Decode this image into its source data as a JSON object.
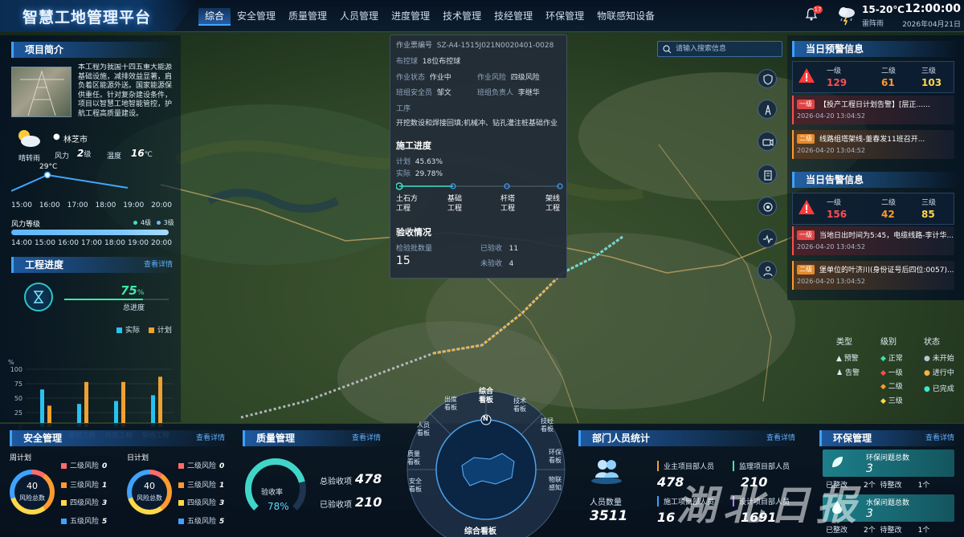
{
  "header": {
    "title": "智慧工地管理平台",
    "nav": [
      "综合",
      "安全管理",
      "质量管理",
      "人员管理",
      "进度管理",
      "技术管理",
      "技经管理",
      "环保管理",
      "物联感知设备"
    ],
    "active_nav": 0,
    "notification_count": "17",
    "weather": {
      "temp": "15-20℃",
      "condition": "雷阵雨"
    },
    "time": "12:00:00",
    "date": "2026年04月21日"
  },
  "project_intro": {
    "title": "项目简介",
    "text": "本工程为我国十四五重大能源基础设施，减排效益显著，肩负着区能源外送。国家能源保供重任。针对复杂建设条件，项目以智慧工地智能管控，护航工程高质量建设。",
    "city": "林芝市",
    "weather_label": "晴转雨",
    "wind_label": "风力",
    "wind_value": "2",
    "wind_unit": "级",
    "temp_label": "温度",
    "temp_value": "16",
    "temp_unit": "℃",
    "current_temp": "29°C",
    "time_ticks": [
      "15:00",
      "16:00",
      "17:00",
      "18:00",
      "19:00",
      "20:00"
    ],
    "wind_level_title": "风力等级",
    "wind_legend": [
      "4级",
      "3级"
    ],
    "wind_ticks": [
      "14:00",
      "15:00",
      "16:00",
      "17:00",
      "18:00",
      "19:00",
      "20:00"
    ]
  },
  "progress": {
    "title": "工程进度",
    "more": "查看详情",
    "percent": "75",
    "percent_unit": "%",
    "label": "总进度",
    "percent_value": 75
  },
  "chart_data": {
    "type": "bar",
    "ylabel": "%",
    "ylim": [
      0,
      100
    ],
    "yticks": [
      "0",
      "25",
      "50",
      "75",
      "100"
    ],
    "categories": [
      "土石方工程",
      "基础工程",
      "杆塔工程",
      "架线工程"
    ],
    "series": [
      {
        "name": "实际",
        "values": [
          65,
          40,
          45,
          55
        ]
      },
      {
        "name": "计划",
        "values": [
          37,
          78,
          78,
          87
        ]
      }
    ],
    "colors": [
      "#27c2f0",
      "#f0a030"
    ]
  },
  "popup": {
    "order_label": "作业票编号",
    "order_value": "SZ-A4-1515J021N0020401-0028",
    "section_label": "布控球",
    "section_value": "18位布控球",
    "status_label": "作业状态",
    "status_value": "作业中",
    "risk_label": "作业风险",
    "risk_value": "四级风险",
    "safety_label": "班组安全员",
    "safety_value": "邹文",
    "leader_label": "班组负责人",
    "leader_value": "李继华",
    "process_label": "工序",
    "process_value": "开挖数设和焊接回填;机械冲、钻孔灌注桩基础作业",
    "construction_title": "施工进度",
    "plan_label": "计划",
    "plan_value": "45.63%",
    "actual_label": "实际",
    "actual_value": "29.78%",
    "stages": [
      "土石方\n工程",
      "基础\n工程",
      "杆塔\n工程",
      "架线\n工程"
    ],
    "acceptance_title": "验收情况",
    "batch_label": "检验批数量",
    "batch_value": "15",
    "accepted_label": "已验收",
    "accepted_value": "11",
    "pending_label": "未验收",
    "pending_value": "4"
  },
  "search": {
    "placeholder": "请输入搜索信息"
  },
  "warning": {
    "title": "当日预警信息",
    "levels": [
      {
        "label": "一级",
        "value": "129",
        "color": "#ff4d4f"
      },
      {
        "label": "二级",
        "value": "61",
        "color": "#ff9a2e"
      },
      {
        "label": "三级",
        "value": "103",
        "color": "#ffd84a"
      }
    ],
    "items": [
      {
        "tag": "一级",
        "text": "【投产工程日计划告警】[层正......",
        "time": "2026-04-20 13:04:52",
        "color": "#ff4d4f"
      },
      {
        "tag": "二级",
        "text": "线路组塔架线-董春发11班召开...",
        "time": "2026-04-20 13:04:52",
        "color": "#ff9a2e"
      }
    ]
  },
  "alarm": {
    "title": "当日告警信息",
    "levels": [
      {
        "label": "一级",
        "value": "156",
        "color": "#ff4d4f"
      },
      {
        "label": "二级",
        "value": "42",
        "color": "#ff9a2e"
      },
      {
        "label": "三级",
        "value": "85",
        "color": "#ffd84a"
      }
    ],
    "items": [
      {
        "tag": "一级",
        "text": "当地日出时间为5:45，电缆线路-李计华...",
        "time": "2026-04-20 13:04:52",
        "color": "#ff4d4f"
      },
      {
        "tag": "二级",
        "text": "堡单位的叶济川(身份证号后四位:0057)...",
        "time": "2026-04-20 13:04:52",
        "color": "#ff9a2e"
      }
    ]
  },
  "legend": {
    "type_title": "类型",
    "level_title": "级别",
    "status_title": "状态",
    "types": [
      "预警",
      "告警"
    ],
    "levels": [
      "正常",
      "一级",
      "二级",
      "三级"
    ],
    "statuses": [
      "未开始",
      "进行中",
      "已完成"
    ]
  },
  "safety": {
    "title": "安全管理",
    "more": "查看详情",
    "weekly": {
      "label": "周计划",
      "total": "40",
      "total_label": "风险总数",
      "items": [
        {
          "l": "二级风险",
          "v": "0"
        },
        {
          "l": "三级风险",
          "v": "1"
        },
        {
          "l": "四级风险",
          "v": "3"
        },
        {
          "l": "五级风险",
          "v": "5"
        }
      ]
    },
    "daily": {
      "label": "日计划",
      "total": "40",
      "total_label": "风险总数",
      "items": [
        {
          "l": "二级风险",
          "v": "0"
        },
        {
          "l": "三级风险",
          "v": "1"
        },
        {
          "l": "四级风险",
          "v": "3"
        },
        {
          "l": "五级风险",
          "v": "5"
        }
      ]
    }
  },
  "quality": {
    "title": "质量管理",
    "more": "查看详情",
    "gauge_label": "验收率",
    "gauge_value": "78%",
    "gauge_fraction": 0.78,
    "total_label": "总验收项",
    "total_value": "478",
    "done_label": "已验收项",
    "done_value": "210"
  },
  "compass": {
    "center_top": "综合\n看板",
    "north": "N",
    "bottom": "综合看板",
    "sectors": [
      "出度\n看板",
      "技术\n看板",
      "技经\n看板",
      "环保\n看板",
      "物联\n感知",
      "安全\n看板",
      "质量\n看板",
      "人员\n看板"
    ]
  },
  "staff": {
    "title": "部门人员统计",
    "more": "查看详情",
    "total_label": "人员数量",
    "total": "3511",
    "items": [
      {
        "l": "业主项目部人员",
        "v": "478"
      },
      {
        "l": "监理项目部人员",
        "v": "210"
      },
      {
        "l": "施工项目部人员",
        "v": "16"
      },
      {
        "l": "设计项目部人员",
        "v": "1691"
      }
    ]
  },
  "env": {
    "title": "环保管理",
    "more": "查看详情",
    "cards": [
      {
        "title": "环保问题总数",
        "total": "3",
        "fixed_label": "已整改",
        "fixed": "2",
        "pending_label": "待整改",
        "pending": "1"
      },
      {
        "title": "水保问题总数",
        "total": "3",
        "fixed_label": "已整改",
        "fixed": "2",
        "pending_label": "待整改",
        "pending": "1"
      }
    ]
  },
  "watermark": "湖北日报"
}
